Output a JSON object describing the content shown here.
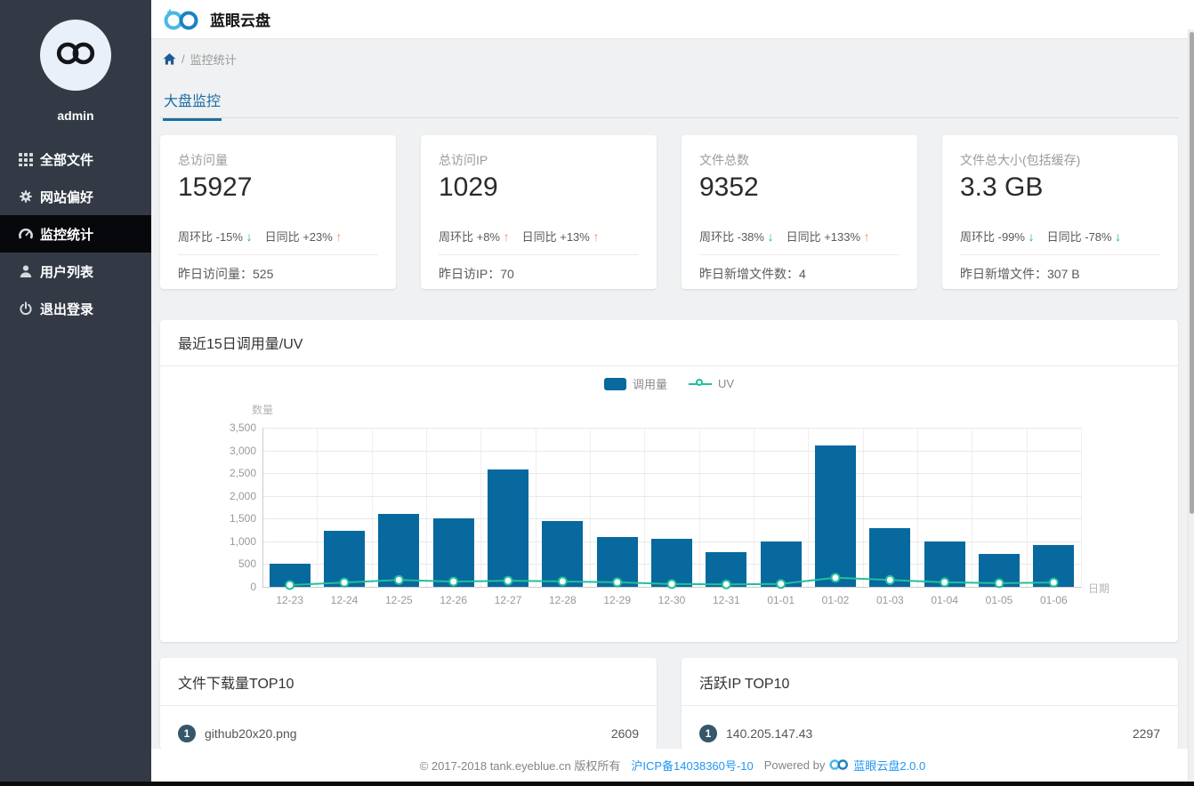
{
  "colors": {
    "bar": "#07699d",
    "line": "#22bf9d",
    "up_arrow": "#f5886c",
    "down_arrow": "#0cb795",
    "accent_blue": "#1b6ca5",
    "link_blue": "#2196f3",
    "badge": "#35566b",
    "sidebar_bg": "#333a46",
    "sidebar_active_bg": "#07080b",
    "logo_light_blue": "#49b8e8",
    "logo_dark_blue": "#1b82c4"
  },
  "header": {
    "app_title": "蓝眼云盘"
  },
  "sidebar": {
    "username": "admin",
    "items": [
      {
        "id": "all-files",
        "icon": "grid-icon",
        "label": "全部文件",
        "active": false
      },
      {
        "id": "site-preferences",
        "icon": "gear-icon",
        "label": "网站偏好",
        "active": false
      },
      {
        "id": "monitor-stats",
        "icon": "dashboard-icon",
        "label": "监控统计",
        "active": true
      },
      {
        "id": "user-list",
        "icon": "user-icon",
        "label": "用户列表",
        "active": false
      },
      {
        "id": "logout",
        "icon": "power-icon",
        "label": "退出登录",
        "active": false
      }
    ]
  },
  "breadcrumb": {
    "separator": "/",
    "current": "监控统计"
  },
  "tabs": [
    {
      "label": "大盘监控",
      "active": true
    }
  ],
  "stat_cards": [
    {
      "title": "总访问量",
      "value": "15927",
      "delta1_label": "周环比",
      "delta1_value": "-15%",
      "delta1_dir": "down",
      "delta2_label": "日同比",
      "delta2_value": "+23%",
      "delta2_dir": "up",
      "footer_label": "昨日访问量：",
      "footer_value": "525"
    },
    {
      "title": "总访问IP",
      "value": "1029",
      "delta1_label": "周环比",
      "delta1_value": "+8%",
      "delta1_dir": "up",
      "delta2_label": "日同比",
      "delta2_value": "+13%",
      "delta2_dir": "up",
      "footer_label": "昨日访IP：",
      "footer_value": "70"
    },
    {
      "title": "文件总数",
      "value": "9352",
      "delta1_label": "周环比",
      "delta1_value": "-38%",
      "delta1_dir": "down",
      "delta2_label": "日同比",
      "delta2_value": "+133%",
      "delta2_dir": "up",
      "footer_label": "昨日新增文件数：",
      "footer_value": "4"
    },
    {
      "title": "文件总大小(包括缓存)",
      "value": "3.3 GB",
      "delta1_label": "周环比",
      "delta1_value": "-99%",
      "delta1_dir": "down",
      "delta2_label": "日同比",
      "delta2_value": "-78%",
      "delta2_dir": "down",
      "footer_label": "昨日新增文件：",
      "footer_value": "307 B"
    }
  ],
  "chart_data": {
    "type": "bar+line",
    "title": "最近15日调用量/UV",
    "categories": [
      "12-23",
      "12-24",
      "12-25",
      "12-26",
      "12-27",
      "12-28",
      "12-29",
      "12-30",
      "12-31",
      "01-01",
      "01-02",
      "01-03",
      "01-04",
      "01-05",
      "01-06"
    ],
    "series": [
      {
        "name": "调用量",
        "type": "bar",
        "values": [
          510,
          1240,
          1610,
          1500,
          2590,
          1440,
          1090,
          1060,
          770,
          990,
          3100,
          1290,
          990,
          730,
          915
        ]
      },
      {
        "name": "UV",
        "type": "line",
        "values": [
          40,
          95,
          150,
          115,
          135,
          120,
          100,
          60,
          55,
          65,
          200,
          150,
          100,
          80,
          95
        ]
      }
    ],
    "ylabel": "数量",
    "xlabel": "日期",
    "ylim": [
      0,
      3500
    ],
    "ytick_values": [
      0,
      500,
      1000,
      1500,
      2000,
      2500,
      3000,
      3500
    ],
    "ytick_labels": [
      "0",
      "500",
      "1,000",
      "1,500",
      "2,000",
      "2,500",
      "3,000",
      "3,500"
    ],
    "legend_position": "top-center",
    "grid": true
  },
  "top_downloads": {
    "title": "文件下载量TOP10",
    "rows": [
      {
        "rank": "1",
        "label": "github20x20.png",
        "value": "2609"
      }
    ]
  },
  "top_ips": {
    "title": "活跃IP TOP10",
    "rows": [
      {
        "rank": "1",
        "label": "140.205.147.43",
        "value": "2297"
      }
    ]
  },
  "footer": {
    "copyright": "© 2017-2018 tank.eyeblue.cn 版权所有",
    "icp_link": "沪ICP备14038360号-10",
    "powered_by": "Powered by",
    "brand_link": "蓝眼云盘2.0.0"
  }
}
